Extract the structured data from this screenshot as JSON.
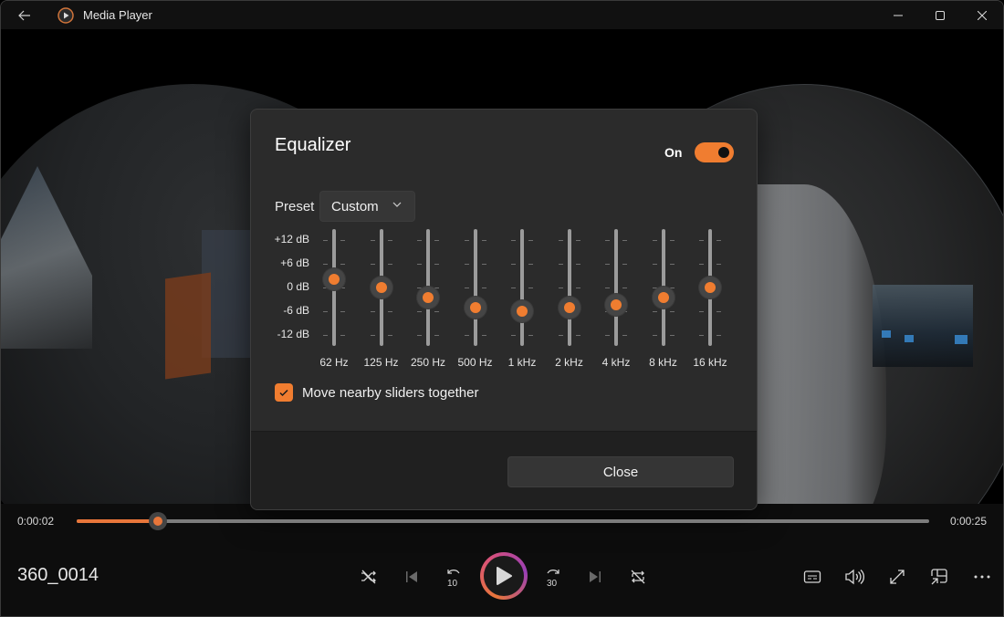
{
  "titlebar": {
    "title": "Media Player",
    "icons": {
      "back": "back-arrow-icon",
      "app": "media-player-icon",
      "minimize": "minimize-icon",
      "maximize": "maximize-icon",
      "close": "close-icon"
    }
  },
  "dialog": {
    "title": "Equalizer",
    "toggle_label": "On",
    "toggle_on": true,
    "preset_label": "Preset",
    "preset_value": "Custom",
    "db_labels": [
      "+12 dB",
      "+6 dB",
      "0 dB",
      "-6 dB",
      "-12 dB"
    ],
    "db_range": [
      -12,
      12
    ],
    "bands": [
      {
        "freq": "62 Hz",
        "gain_db": 2
      },
      {
        "freq": "125 Hz",
        "gain_db": 0
      },
      {
        "freq": "250 Hz",
        "gain_db": -2.5
      },
      {
        "freq": "500 Hz",
        "gain_db": -5
      },
      {
        "freq": "1 kHz",
        "gain_db": -6
      },
      {
        "freq": "2 kHz",
        "gain_db": -5
      },
      {
        "freq": "4 kHz",
        "gain_db": -4.3
      },
      {
        "freq": "8 kHz",
        "gain_db": -2.5
      },
      {
        "freq": "16 kHz",
        "gain_db": 0
      }
    ],
    "checkbox_label": "Move nearby sliders together",
    "checkbox_checked": true,
    "close_label": "Close"
  },
  "player": {
    "current_time": "0:00:02",
    "total_time": "0:00:25",
    "progress_fraction": 0.095,
    "media_title": "360_0014",
    "accent": "#e8763a",
    "controls": {
      "shuffle": "shuffle-off-icon",
      "previous": "previous-icon",
      "rewind": "rewind-10-icon",
      "rewind_label": "10",
      "play": "play-icon",
      "forward": "forward-30-icon",
      "forward_label": "30",
      "next": "next-icon",
      "repeat": "repeat-off-icon",
      "captions": "captions-icon",
      "volume": "volume-icon",
      "fullscreen": "fullscreen-icon",
      "miniplayer": "miniplayer-icon",
      "more": "more-options-icon"
    }
  }
}
